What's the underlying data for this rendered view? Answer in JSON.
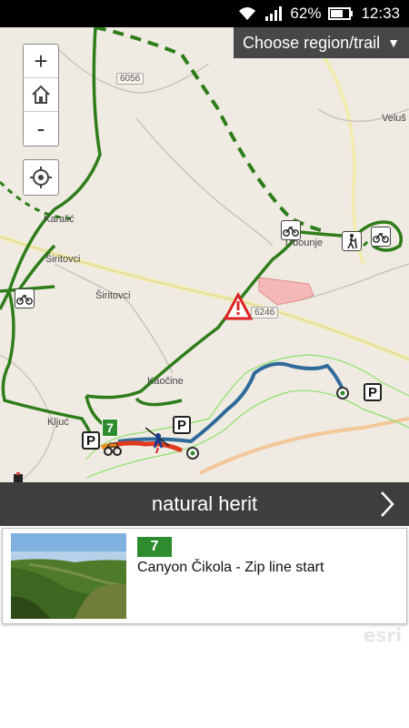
{
  "status_bar": {
    "battery_percent": "62%",
    "time": "12:33",
    "icons": [
      "wifi-icon",
      "signal-icon",
      "battery-icon"
    ]
  },
  "map": {
    "region_button_label": "Choose region/trail",
    "region_button_arrow": "▼",
    "zoom_in_label": "+",
    "zoom_out_label": "-",
    "place_labels": [
      "Karalić",
      "Širitovci",
      "Širitovci",
      "Trbounje",
      "Veluš",
      "Kaočine",
      "Kljuć"
    ],
    "road_numbers": [
      "6056",
      "6246"
    ],
    "poi_markers": {
      "parking_label": "P",
      "trail_number": "7"
    },
    "colors": {
      "trail_green": "#2e7d1a",
      "river_blue": "#2f6a9a",
      "route_red": "#e03a1e",
      "terrain_bg": "#efebe3"
    }
  },
  "info_bar": {
    "title": "natural herit",
    "next_icon": "chevron-right-icon"
  },
  "result_card": {
    "badge": "7",
    "name": "Canyon Čikola - Zip line start"
  },
  "attribution": "esri"
}
